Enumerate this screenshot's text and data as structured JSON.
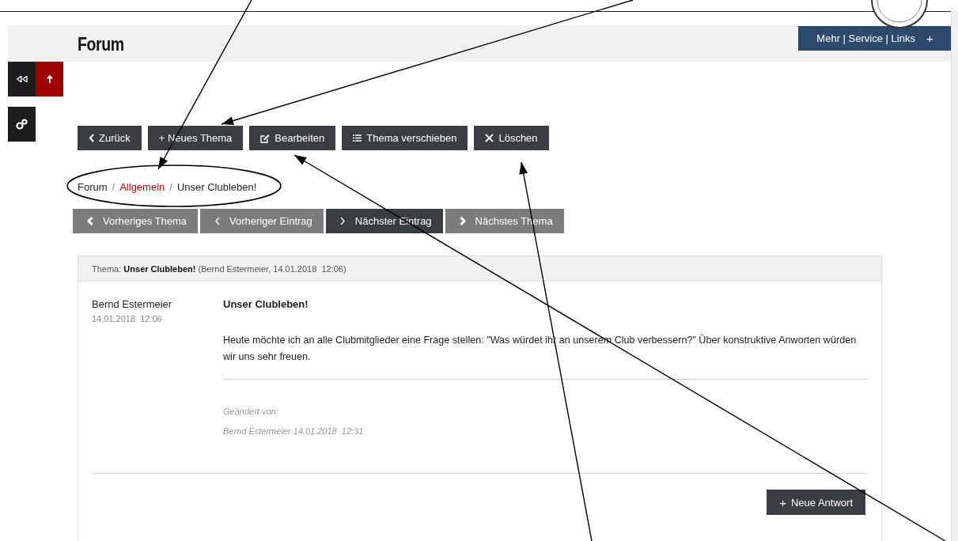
{
  "header": {
    "title": "Forum",
    "menu_button": "Mehr | Service | Links",
    "menu_icon": "+"
  },
  "actions": [
    {
      "label": "Zurück"
    },
    {
      "label": "+ Neues Thema"
    },
    {
      "label": "Bearbeiten"
    },
    {
      "label": "Thema verschieben"
    },
    {
      "label": "Löschen"
    }
  ],
  "breadcrumb": [
    {
      "label": "Forum",
      "link": false
    },
    {
      "label": "Allgemein",
      "link": true
    },
    {
      "label": "Unser Clubleben!",
      "link": false
    }
  ],
  "breadcrumb_separator": "/",
  "pager": [
    {
      "label": "Vorheriges Thema",
      "disabled": true
    },
    {
      "label": "Vorheriger Eintrag",
      "disabled": true
    },
    {
      "label": "Nächster Eintrag",
      "disabled": false
    },
    {
      "label": "Nächstes Thema",
      "disabled": true
    }
  ],
  "topic": {
    "prefix": "Thema:",
    "title": "Unser Clubleben!",
    "meta_author": "(Bernd Estermeier,",
    "meta_date": "14.01.2018  12:06)"
  },
  "post": {
    "author": "Bernd Estermeier",
    "date": "14.01.2018  12:06",
    "title": "Unser Clubleben!",
    "body": "Heute möchte ich an alle Clubmitglieder eine Frage stellen: \"Was würdet ihr an unserem Club verbessern?\" Über konstruktive Anworten würden wir uns sehr freuen.",
    "edited_label": "Geändert von:",
    "edited_by": "Bernd Estermeier 14.01.2018  12:31"
  },
  "reply_button": {
    "icon": "+",
    "label": "Neue Antwort"
  }
}
